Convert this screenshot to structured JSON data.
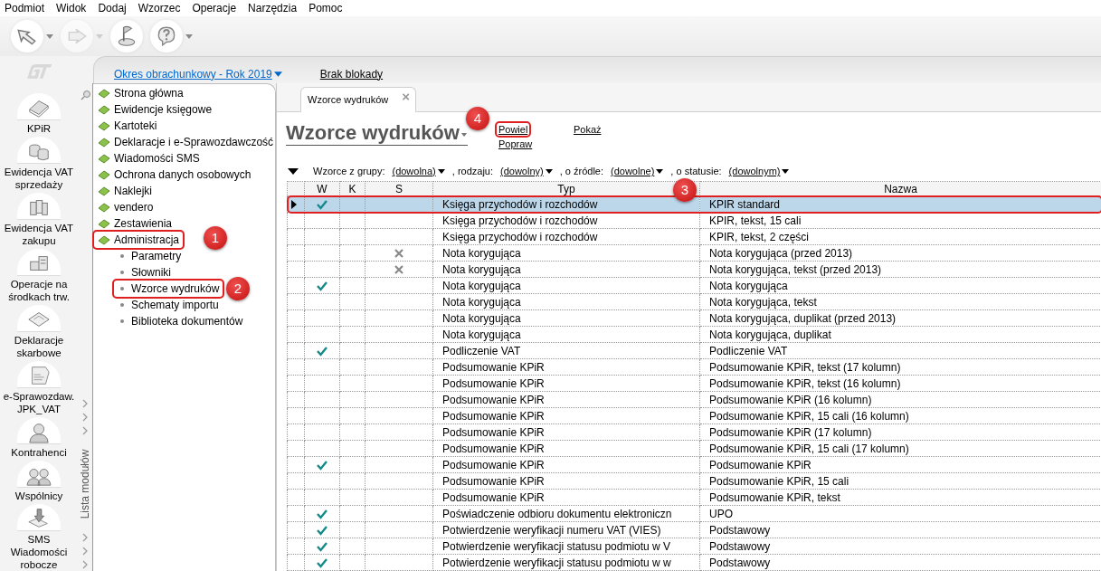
{
  "menu": [
    "Podmiot",
    "Widok",
    "Dodaj",
    "Wzorzec",
    "Operacje",
    "Narzędzia",
    "Pomoc"
  ],
  "toolbar": [
    {
      "kind": "arrow-left",
      "dropdown": true,
      "disabled": false
    },
    {
      "kind": "arrow-right",
      "dropdown": true,
      "disabled": true
    },
    {
      "kind": "flag",
      "dropdown": false,
      "disabled": false
    },
    {
      "kind": "help",
      "dropdown": true,
      "disabled": false
    }
  ],
  "modules": [
    {
      "kind": "book",
      "label": "KPiR"
    },
    {
      "kind": "coins",
      "label": "Ewidencja VAT sprzedaży"
    },
    {
      "kind": "binders",
      "label": "Ewidencja VAT zakupu"
    },
    {
      "kind": "machine",
      "label": "Operacje na środkach trw."
    },
    {
      "kind": "form",
      "label": "Deklaracje skarbowe"
    },
    {
      "kind": "jpk",
      "label": "e-Sprawozdaw. JPK_VAT"
    },
    {
      "kind": "person",
      "label": "Kontrahenci"
    },
    {
      "kind": "people",
      "label": "Wspólnicy"
    },
    {
      "kind": "sms",
      "label": "SMS Wiadomości robocze"
    }
  ],
  "period_bar": {
    "period": "Okres obrachunkowy - Rok 2019",
    "lock": "Brak blokady"
  },
  "module_strip": {
    "label": "Lista modułów"
  },
  "nav": [
    {
      "label": "Strona główna",
      "highlighted": false
    },
    {
      "label": "Ewidencje księgowe",
      "highlighted": false
    },
    {
      "label": "Kartoteki",
      "highlighted": false
    },
    {
      "label": "Deklaracje i e-Sprawozdawczość",
      "highlighted": false
    },
    {
      "label": "Wiadomości SMS",
      "highlighted": false
    },
    {
      "label": "Ochrona danych osobowych",
      "highlighted": false
    },
    {
      "label": "Naklejki",
      "highlighted": false
    },
    {
      "label": "vendero",
      "highlighted": false
    },
    {
      "label": "Zestawienia",
      "highlighted": false
    },
    {
      "label": "Administracja",
      "highlighted": true,
      "badge": "1",
      "children": [
        {
          "label": "Parametry",
          "highlighted": false
        },
        {
          "label": "Słowniki",
          "highlighted": false
        },
        {
          "label": "Wzorce wydruków",
          "highlighted": true,
          "badge": "2"
        },
        {
          "label": "Schematy importu",
          "highlighted": false
        },
        {
          "label": "Biblioteka dokumentów",
          "highlighted": false
        }
      ]
    }
  ],
  "tabs": [
    {
      "label": "Wzorce wydruków",
      "selected": true,
      "close": "×"
    }
  ],
  "title": "Wzorce wydruków",
  "actions": [
    {
      "label": "Powiel",
      "highlighted": true,
      "badge": "4"
    },
    {
      "label": "Popraw",
      "highlighted": false
    },
    {
      "label": "Pokaż",
      "highlighted": false
    }
  ],
  "filter": [
    {
      "kind": "text",
      "text": "Wzorce z grupy:"
    },
    {
      "kind": "dropdown",
      "text": "(dowolna)"
    },
    {
      "kind": "text",
      "text": ", rodzaju:"
    },
    {
      "kind": "dropdown",
      "text": "(dowolny)"
    },
    {
      "kind": "text",
      "text": ", o źródle:"
    },
    {
      "kind": "dropdown",
      "text": "(dowolne)"
    },
    {
      "kind": "text",
      "text": ", o statusie:"
    },
    {
      "kind": "dropdown",
      "text": "(dowolnym)"
    }
  ],
  "table": {
    "columns": [
      "W",
      "K",
      "S",
      "Typ",
      "Nazwa"
    ],
    "badge": "3",
    "rows": [
      {
        "selected": true,
        "w": true,
        "s": false,
        "typ": "Księga przychodów i rozchodów",
        "nazwa": "KPIR standard"
      },
      {
        "selected": false,
        "w": false,
        "s": false,
        "typ": "Księga przychodów i rozchodów",
        "nazwa": "KPIR, tekst, 15 cali"
      },
      {
        "selected": false,
        "w": false,
        "s": false,
        "typ": "Księga przychodów i rozchodów",
        "nazwa": "KPIR, tekst, 2 części"
      },
      {
        "selected": false,
        "w": false,
        "s": true,
        "typ": "Nota korygująca",
        "nazwa": "Nota korygująca (przed 2013)"
      },
      {
        "selected": false,
        "w": false,
        "s": true,
        "typ": "Nota korygująca",
        "nazwa": "Nota korygująca, tekst (przed 2013)"
      },
      {
        "selected": false,
        "w": true,
        "s": false,
        "typ": "Nota korygująca",
        "nazwa": "Nota korygująca"
      },
      {
        "selected": false,
        "w": false,
        "s": false,
        "typ": "Nota korygująca",
        "nazwa": "Nota korygująca, tekst"
      },
      {
        "selected": false,
        "w": false,
        "s": false,
        "typ": "Nota korygująca",
        "nazwa": "Nota korygująca, duplikat (przed 2013)"
      },
      {
        "selected": false,
        "w": false,
        "s": false,
        "typ": "Nota korygująca",
        "nazwa": "Nota korygująca, duplikat"
      },
      {
        "selected": false,
        "w": true,
        "s": false,
        "typ": "Podliczenie VAT",
        "nazwa": "Podliczenie VAT"
      },
      {
        "selected": false,
        "w": false,
        "s": false,
        "typ": "Podsumowanie KPiR",
        "nazwa": "Podsumowanie KPiR, tekst (17 kolumn)"
      },
      {
        "selected": false,
        "w": false,
        "s": false,
        "typ": "Podsumowanie KPiR",
        "nazwa": "Podsumowanie KPiR, tekst (16 kolumn)"
      },
      {
        "selected": false,
        "w": false,
        "s": false,
        "typ": "Podsumowanie KPiR",
        "nazwa": "Podsumowanie KPiR (16 kolumn)"
      },
      {
        "selected": false,
        "w": false,
        "s": false,
        "typ": "Podsumowanie KPiR",
        "nazwa": "Podsumowanie KPiR, 15 cali (16 kolumn)"
      },
      {
        "selected": false,
        "w": false,
        "s": false,
        "typ": "Podsumowanie KPiR",
        "nazwa": "Podsumowanie KPiR (17 kolumn)"
      },
      {
        "selected": false,
        "w": false,
        "s": false,
        "typ": "Podsumowanie KPiR",
        "nazwa": "Podsumowanie KPiR, 15 cali (17 kolumn)"
      },
      {
        "selected": false,
        "w": true,
        "s": false,
        "typ": "Podsumowanie KPiR",
        "nazwa": "Podsumowanie KPiR"
      },
      {
        "selected": false,
        "w": false,
        "s": false,
        "typ": "Podsumowanie KPiR",
        "nazwa": "Podsumowanie KPiR, 15 cali"
      },
      {
        "selected": false,
        "w": false,
        "s": false,
        "typ": "Podsumowanie KPiR",
        "nazwa": "Podsumowanie KPiR, tekst"
      },
      {
        "selected": false,
        "w": true,
        "s": false,
        "typ": "Poświadczenie odbioru dokumentu elektroniczn",
        "nazwa": "UPO"
      },
      {
        "selected": false,
        "w": true,
        "s": false,
        "typ": "Potwierdzenie weryfikacji numeru VAT (VIES)",
        "nazwa": "Podstawowy"
      },
      {
        "selected": false,
        "w": true,
        "s": false,
        "typ": "Potwierdzenie weryfikacji statusu podmiotu w V",
        "nazwa": "Podstawowy"
      },
      {
        "selected": false,
        "w": true,
        "s": false,
        "typ": "Potwierdzenie weryfikacji statusu podmiotu w w",
        "nazwa": "Podstawowy"
      }
    ]
  }
}
